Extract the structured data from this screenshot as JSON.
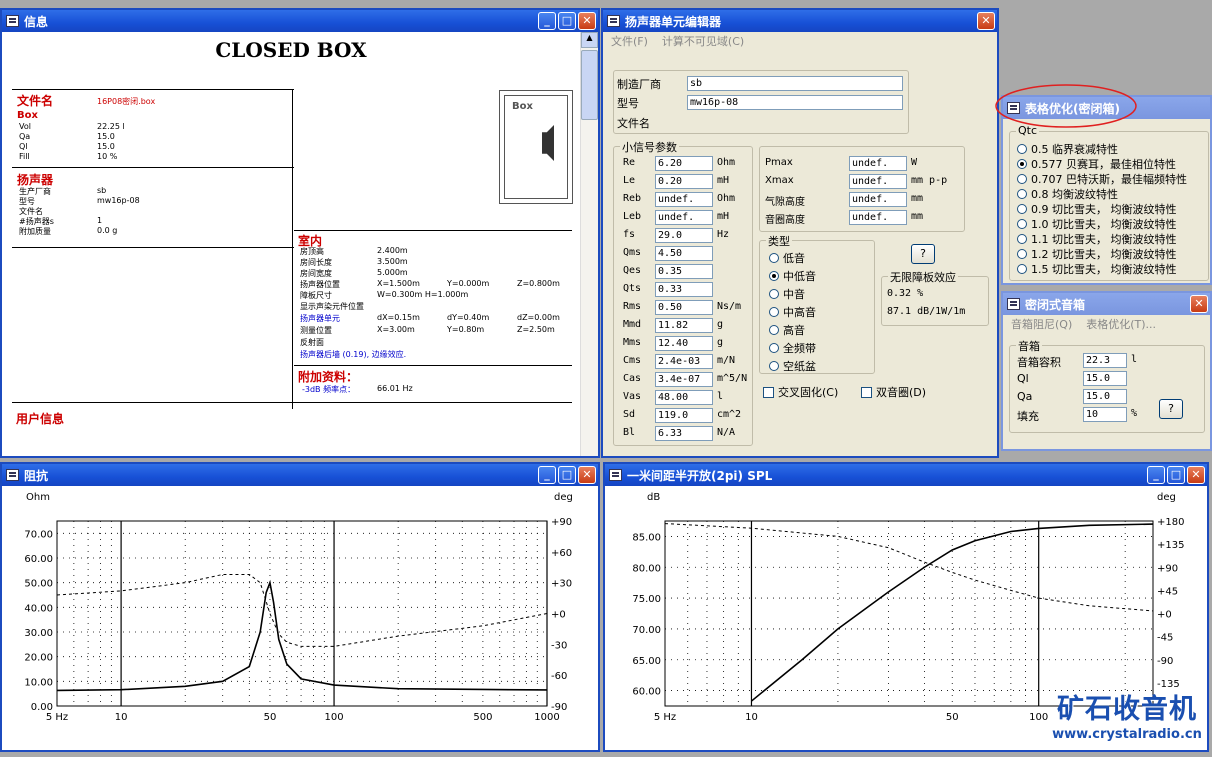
{
  "info": {
    "title": "信息",
    "heading": "CLOSED BOX",
    "file_label": "文件名",
    "file_value": "16P08密闭.box",
    "box_head": "Box",
    "box_rows": [
      [
        "Vol",
        "22.25 l"
      ],
      [
        "Qa",
        "15.0"
      ],
      [
        "Ql",
        "15.0"
      ],
      [
        "Fill",
        "10 %"
      ]
    ],
    "speaker_head": "扬声器",
    "speaker_rows": [
      [
        "生产厂商",
        "sb"
      ],
      [
        "型号",
        "mw16p-08"
      ],
      [
        "文件名",
        ""
      ],
      [
        "#扬声器s",
        "1"
      ],
      [
        "附加质量",
        "0.0 g"
      ]
    ],
    "room_head": "室内",
    "room_rows": [
      [
        "房顶高",
        "2.400m"
      ],
      [
        "房间长度",
        "3.500m"
      ],
      [
        "房间宽度",
        "5.000m"
      ]
    ],
    "room_pos": [
      {
        "l": "扬声器位置",
        "x": "X=1.500m",
        "y": "Y=0.000m",
        "z": "Z=0.800m"
      }
    ],
    "baffle": [
      "障板尺寸",
      "W=0.300m H=1.000m"
    ],
    "show_pos": "显示声染元件位置",
    "spk_unit": [
      "扬声器单元",
      "dX=0.15m",
      "dY=0.40m",
      "dZ=0.00m"
    ],
    "mic": [
      "测量位置",
      "X=3.00m",
      "Y=0.80m",
      "Z=2.50m"
    ],
    "reflect": "反射面",
    "rear_wall": "扬声器后墙 (0.19), 边缘效应.",
    "extra_head": "附加资料：",
    "extra_row": [
      "-3dB 频率点：",
      "66.01 Hz"
    ],
    "user_head": "用户信息",
    "box_pic": "Box"
  },
  "editor": {
    "title": "扬声器单元编辑器",
    "menu": [
      "文件(F)",
      "计算不可见域(C)"
    ],
    "mfr_label": "制造厂商",
    "mfr": "sb",
    "model_label": "型号",
    "model": "mw16p-08",
    "file_label": "文件名",
    "small_sig": "小信号参数",
    "params": [
      [
        "Re",
        "6.20",
        "Ohm"
      ],
      [
        "Le",
        "0.20",
        "mH"
      ],
      [
        "Reb",
        "undef.",
        "Ohm"
      ],
      [
        "Leb",
        "undef.",
        "mH"
      ],
      [
        "fs",
        "29.0",
        "Hz"
      ],
      [
        "Qms",
        "4.50",
        ""
      ],
      [
        "Qes",
        "0.35",
        ""
      ],
      [
        "Qts",
        "0.33",
        ""
      ],
      [
        "Rms",
        "0.50",
        "Ns/m"
      ],
      [
        "Mmd",
        "11.82",
        "g"
      ],
      [
        "Mms",
        "12.40",
        "g"
      ],
      [
        "Cms",
        "2.4e-03",
        "m/N"
      ],
      [
        "Cas",
        "3.4e-07",
        "m^5/N"
      ],
      [
        "Vas",
        "48.00",
        "l"
      ],
      [
        "Sd",
        "119.0",
        "cm^2"
      ],
      [
        "Bl",
        "6.33",
        "N/A"
      ]
    ],
    "right_params": [
      [
        "Pmax",
        "undef.",
        "W"
      ],
      [
        "Xmax",
        "undef.",
        "mm p-p"
      ],
      [
        "气隙高度",
        "undef.",
        "mm"
      ],
      [
        "音圈高度",
        "undef.",
        "mm"
      ]
    ],
    "type_label": "类型",
    "types": [
      "低音",
      "中低音",
      "中音",
      "中高音",
      "高音",
      "全频带",
      "空纸盆"
    ],
    "type_selected": 1,
    "help": "?",
    "baffle_label": "无限障板效应",
    "baffle_val1": "0.32  %",
    "baffle_val2": "87.1  dB/1W/1m",
    "cb1": "交叉固化(C)",
    "cb2": "双音圈(D)"
  },
  "qtc": {
    "title": "表格优化(密闭箱)",
    "group": "Qtc",
    "options": [
      "0.5 临界衰减特性",
      "0.577 贝赛耳，最佳相位特性",
      "0.707 巴特沃斯，最佳幅频特性",
      "0.8 均衡波纹特性",
      "0.9 切比雪夫， 均衡波纹特性",
      "1.0 切比雪夫， 均衡波纹特性",
      "1.1 切比雪夫， 均衡波纹特性",
      "1.2 切比雪夫， 均衡波纹特性",
      "1.5 切比雪夫， 均衡波纹特性"
    ],
    "selected": 1
  },
  "cbox": {
    "title": "密闭式音箱",
    "menu": [
      "音箱阻尼(Q)",
      "表格优化(T)..."
    ],
    "group": "音箱",
    "rows": [
      [
        "音箱容积",
        "22.3",
        "l"
      ],
      [
        "Ql",
        "15.0",
        ""
      ],
      [
        "Qa",
        "15.0",
        ""
      ],
      [
        "填充",
        "10",
        "%"
      ]
    ],
    "help": "?"
  },
  "imp": {
    "title": "阻抗",
    "yunit": "Ohm",
    "y2unit": "deg",
    "yticks": [
      "70.00",
      "60.00",
      "50.00",
      "40.00",
      "30.00",
      "20.00",
      "10.00",
      "0.00"
    ],
    "y2ticks": [
      "+90",
      "+60",
      "+30",
      "+0",
      "-30",
      "-60",
      "-90"
    ],
    "xticks": [
      "5 Hz",
      "10",
      "50",
      "100",
      "500",
      "1000"
    ]
  },
  "spl": {
    "title": "一米间距半开放(2pi) SPL",
    "yunit": "dB",
    "y2unit": "deg",
    "yticks": [
      "85.00",
      "80.00",
      "75.00",
      "70.00",
      "65.00",
      "60.00"
    ],
    "y2ticks": [
      "+180",
      "+135",
      "+90",
      "+45",
      "+0",
      "-45",
      "-90",
      "-135"
    ],
    "xticks": [
      "5 Hz",
      "10",
      "50",
      "100"
    ]
  },
  "chart_data": [
    {
      "type": "line",
      "title": "阻抗",
      "xlabel": "",
      "ylabel": "Ohm",
      "xlim": [
        5,
        1000
      ],
      "ylim": [
        0,
        75
      ],
      "y2lim": [
        -90,
        90
      ],
      "xscale": "log",
      "series": [
        {
          "x": [
            5,
            10,
            20,
            30,
            40,
            45,
            48,
            50,
            52,
            55,
            60,
            70,
            100,
            200,
            500,
            1000
          ],
          "y": [
            6.3,
            6.6,
            8,
            10,
            16,
            30,
            46,
            50,
            42,
            27,
            17,
            11,
            8.5,
            7,
            6.7,
            6.5
          ]
        },
        {
          "x": [
            5,
            10,
            20,
            30,
            40,
            45,
            50,
            55,
            60,
            70,
            100,
            200,
            500,
            1000
          ],
          "y": [
            18,
            22,
            30,
            38,
            38,
            30,
            0,
            -20,
            -28,
            -32,
            -32,
            -22,
            -12,
            0
          ]
        }
      ]
    },
    {
      "type": "line",
      "title": "一米间距半开放(2pi) SPL",
      "xlabel": "",
      "ylabel": "dB",
      "xlim": [
        5,
        250
      ],
      "ylim": [
        57.5,
        87.5
      ],
      "y2lim": [
        -180,
        180
      ],
      "xscale": "log",
      "series": [
        {
          "x": [
            10,
            15,
            20,
            30,
            40,
            50,
            60,
            80,
            100,
            150,
            250
          ],
          "y": [
            58.3,
            65,
            70,
            76,
            80,
            82.8,
            84.3,
            85.8,
            86.3,
            86.8,
            87
          ]
        },
        {
          "x": [
            5,
            10,
            20,
            30,
            40,
            50,
            60,
            80,
            100,
            150,
            250
          ],
          "y": [
            175,
            166,
            150,
            128,
            100,
            80,
            65,
            45,
            30,
            15,
            5
          ]
        }
      ]
    }
  ],
  "watermark": {
    "cn": "矿石收音机",
    "url": "www.crystalradio.cn"
  }
}
